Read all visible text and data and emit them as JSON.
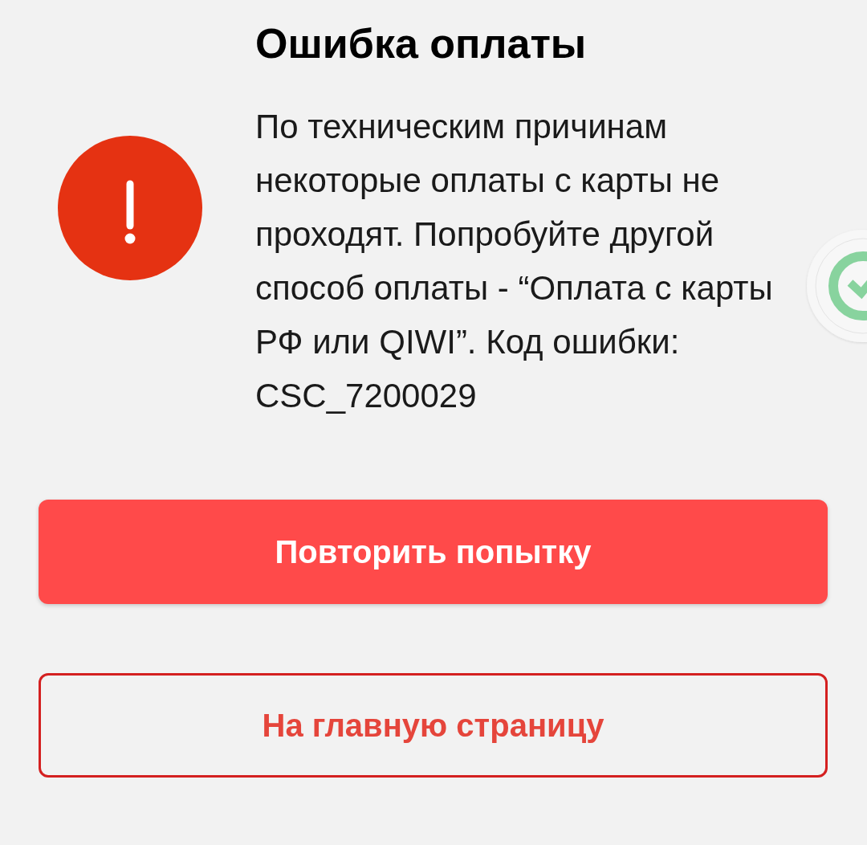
{
  "title": "Ошибка оплаты",
  "message": "По техническим причинам некоторые оплаты с карты не проходят. Попробуйте другой способ оплаты - “Оплата с карты РФ или QIWI”. Код ошибки: CSC_7200029",
  "buttons": [
    {
      "label": "Повторить попытку",
      "kind": "primary"
    },
    {
      "label": "На главную страницу",
      "kind": "secondary"
    }
  ]
}
